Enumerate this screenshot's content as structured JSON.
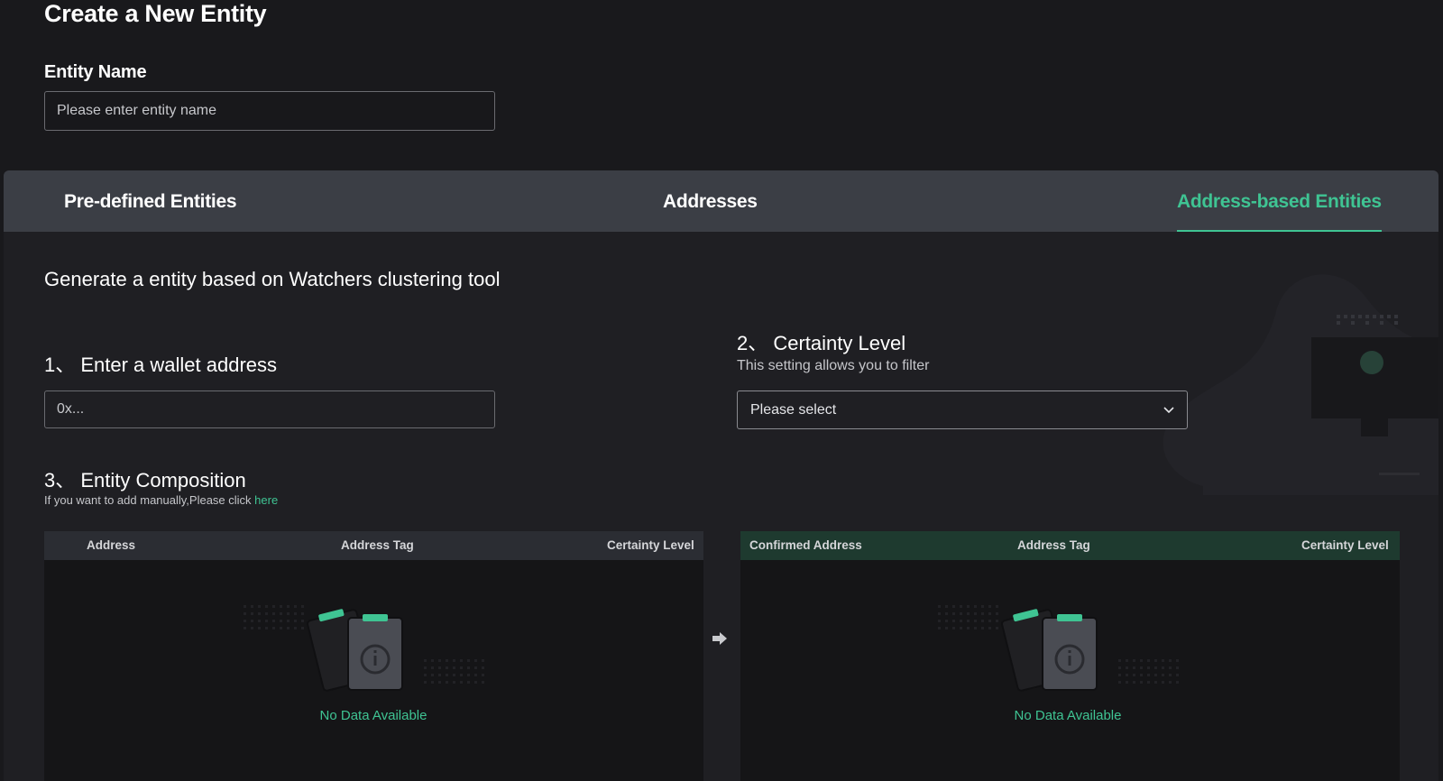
{
  "page": {
    "title": "Create a New Entity",
    "entity_name_label": "Entity Name",
    "entity_name_placeholder": "Please enter entity name"
  },
  "tabs": [
    {
      "label": "Pre-defined Entities",
      "active": false
    },
    {
      "label": "Addresses",
      "active": false
    },
    {
      "label": "Address-based Entities",
      "active": true
    }
  ],
  "content": {
    "intro": "Generate a entity based on Watchers clustering tool",
    "step1": {
      "title": "1、 Enter a wallet address",
      "placeholder": "0x..."
    },
    "step2": {
      "title": "2、 Certainty Level",
      "subtitle": "This setting allows you to filter",
      "select_placeholder": "Please select"
    },
    "step3": {
      "title": "3、 Entity Composition",
      "note": "If you want to add manually,Please click ",
      "link": "here"
    }
  },
  "left_table": {
    "headers": [
      "Address",
      "Address Tag",
      "Certainty Level"
    ],
    "rows": [],
    "empty_text": "No Data Available"
  },
  "right_table": {
    "headers": [
      "Confirmed Address",
      "Address Tag",
      "Certainty Level"
    ],
    "rows": [],
    "empty_text": "No Data Available"
  },
  "icons": {
    "transfer_arrow": "arrow-right-icon",
    "dropdown": "chevron-down-icon",
    "empty_state": "empty-clipboard-icon"
  },
  "colors": {
    "background": "#19191c",
    "panel": "#1f1f23",
    "tab_bar": "#3b3e45",
    "accent": "#3fc493",
    "left_table_header": "#2b2d33",
    "right_table_header": "#1e3a2f"
  }
}
